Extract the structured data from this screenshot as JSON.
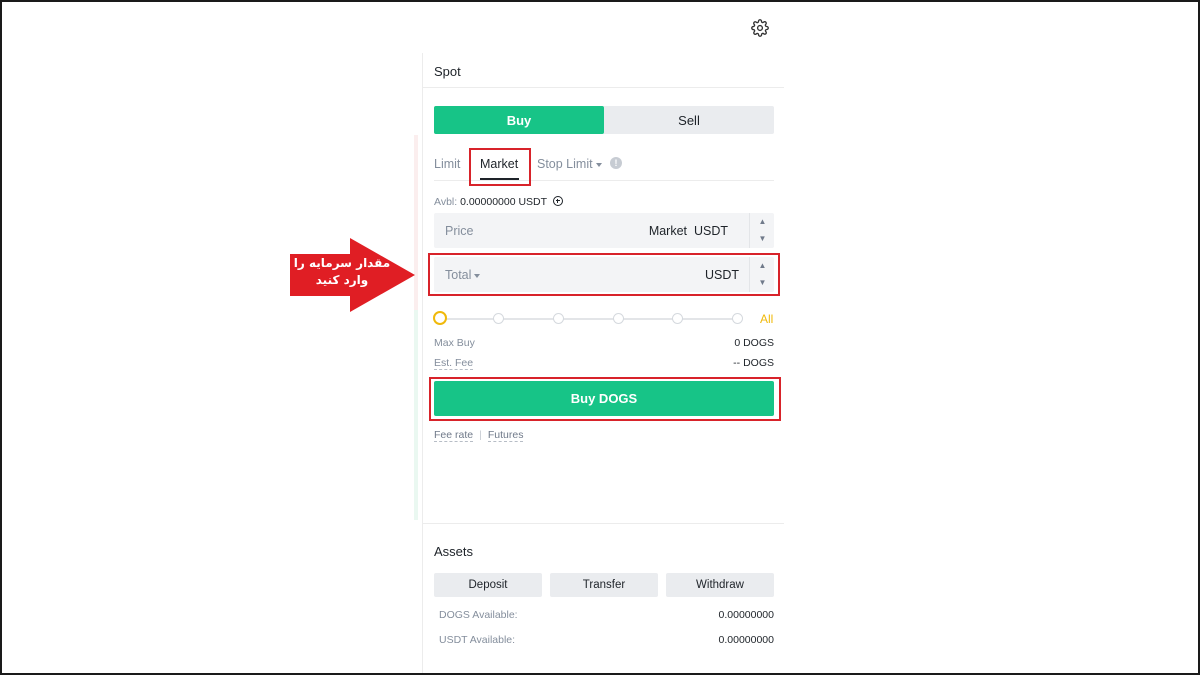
{
  "header": {
    "settings_icon": "gear-icon"
  },
  "panel": {
    "title": "Spot",
    "side_toggle": {
      "buy": "Buy",
      "sell": "Sell",
      "active": "buy"
    },
    "order_tabs": [
      {
        "label": "Limit",
        "active": false
      },
      {
        "label": "Market",
        "active": true
      },
      {
        "label": "Stop Limit",
        "active": false
      }
    ],
    "available": {
      "label": "Avbl:",
      "value": "0.00000000 USDT"
    },
    "price_field": {
      "label": "Price",
      "value": "Market",
      "unit": "USDT"
    },
    "total_field": {
      "label": "Total",
      "unit": "USDT"
    },
    "slider": {
      "all_label": "All",
      "position": 0
    },
    "max_buy": {
      "label": "Max Buy",
      "value": "0 DOGS"
    },
    "est_fee": {
      "label": "Est. Fee",
      "value": "-- DOGS"
    },
    "submit_label": "Buy DOGS",
    "links": {
      "fee_rate": "Fee rate",
      "futures": "Futures"
    }
  },
  "assets": {
    "title": "Assets",
    "buttons": {
      "deposit": "Deposit",
      "transfer": "Transfer",
      "withdraw": "Withdraw"
    },
    "rows": [
      {
        "label": "DOGS Available:",
        "value": "0.00000000"
      },
      {
        "label": "USDT Available:",
        "value": "0.00000000"
      }
    ]
  },
  "annotation": {
    "line1": "مقدار سرمایه را",
    "line2": "وارد کنید",
    "color": "#e01e24"
  },
  "colors": {
    "buy": "#17c487",
    "highlight": "#d8232a",
    "slider": "#f0b90b"
  }
}
